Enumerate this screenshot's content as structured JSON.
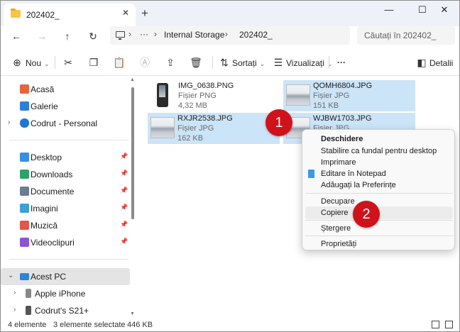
{
  "window": {
    "tab_title": "202402_",
    "tab_close": "✕",
    "new_tab": "+",
    "minimize": "—",
    "maximize": "☐",
    "close": "✕"
  },
  "nav": {
    "back": "←",
    "forward": "→",
    "up": "↑",
    "refresh": "↻",
    "more": "···",
    "breadcrumbs": [
      "Internal Storage",
      "202402_"
    ],
    "separator": "›",
    "search_placeholder": "Căutați în 202402_"
  },
  "toolbar": {
    "new_label": "Nou",
    "sort_label": "Sortați",
    "view_label": "Vizualizați",
    "more": "···",
    "details_label": "Detalii"
  },
  "sidebar": {
    "quick": [
      {
        "label": "Acasă",
        "icon": "home-icon",
        "color": "#e8633a"
      },
      {
        "label": "Galerie",
        "icon": "gallery-icon",
        "color": "#2f7fd6"
      },
      {
        "label": "Codrut - Personal",
        "icon": "onedrive-icon",
        "color": "#1f78d1"
      }
    ],
    "pinned": [
      {
        "label": "Desktop",
        "icon": "desktop-icon",
        "color": "#3a8ee0"
      },
      {
        "label": "Downloads",
        "icon": "downloads-icon",
        "color": "#2ca36b"
      },
      {
        "label": "Documente",
        "icon": "documents-icon",
        "color": "#6b7c93"
      },
      {
        "label": "Imagini",
        "icon": "pictures-icon",
        "color": "#3aa0d8"
      },
      {
        "label": "Muzică",
        "icon": "music-icon",
        "color": "#e4564a"
      },
      {
        "label": "Videoclipuri",
        "icon": "videos-icon",
        "color": "#8a55d4"
      }
    ],
    "pc": [
      {
        "label": "Acest PC",
        "icon": "this-pc-icon",
        "color": "#2a86d9"
      },
      {
        "label": "Apple iPhone",
        "icon": "phone-icon",
        "color": "#888888"
      },
      {
        "label": "Codrut's S21+",
        "icon": "phone-icon",
        "color": "#555555"
      }
    ]
  },
  "files": [
    {
      "name": "IMG_0638.PNG",
      "type": "Fișier PNG",
      "size": "4,32 MB",
      "selected": false
    },
    {
      "name": "QOMH6804.JPG",
      "type": "Fișier JPG",
      "size": "151 KB",
      "selected": true
    },
    {
      "name": "RXJR2538.JPG",
      "type": "Fișier JPG",
      "size": "162 KB",
      "selected": true
    },
    {
      "name": "WJBW1703.JPG",
      "type": "Fișier JPG",
      "size": "",
      "selected": true
    }
  ],
  "context_menu": {
    "items": [
      {
        "label": "Deschidere"
      },
      {
        "label": "Stabilire ca fundal pentru desktop"
      },
      {
        "label": "Imprimare"
      },
      {
        "label": "Editare în Notepad"
      },
      {
        "label": "Adăugați la Preferințe"
      },
      {
        "label": "Decupare"
      },
      {
        "label": "Copiere"
      },
      {
        "label": "Ștergere"
      },
      {
        "label": "Proprietăți"
      }
    ]
  },
  "badges": {
    "one": "1",
    "two": "2"
  },
  "status": {
    "count": "4 elemente",
    "selection": "3 elemente selectate",
    "size": "446 KB"
  },
  "colors": {
    "selection": "#cce4f7",
    "badge": "#d0121b",
    "accent": "#0067c0"
  }
}
